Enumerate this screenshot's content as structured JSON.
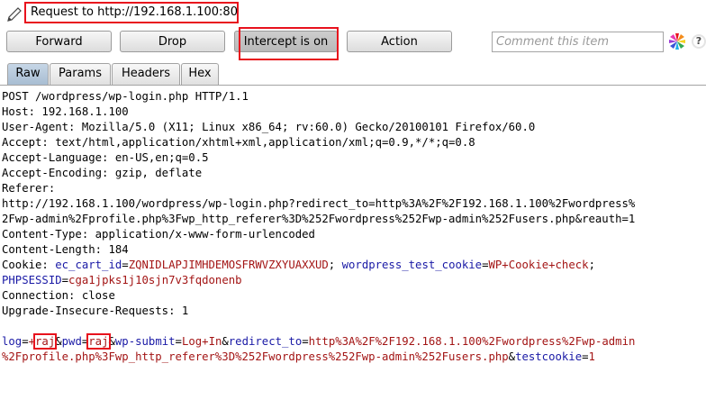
{
  "title": "Request to http://192.168.1.100:80",
  "toolbar": {
    "forward_label": "Forward",
    "drop_label": "Drop",
    "intercept_label": "Intercept is on",
    "action_label": "Action",
    "comment_placeholder": "Comment this item"
  },
  "icons": {
    "edit": "pencil-icon",
    "highlight": "color-palette-icon",
    "help": "help-icon"
  },
  "colors": {
    "param_name": "#1a1aa6",
    "param_value": "#a31515",
    "highlight_box": "#e8121d",
    "active_tab": "#a8bdd2"
  },
  "tabs": [
    "Raw",
    "Params",
    "Headers",
    "Hex"
  ],
  "request": {
    "request_line": "POST /wordpress/wp-login.php HTTP/1.1",
    "host": "Host: 192.168.1.100",
    "user_agent": "User-Agent: Mozilla/5.0 (X11; Linux x86_64; rv:60.0) Gecko/20100101 Firefox/60.0",
    "accept": "Accept: text/html,application/xhtml+xml,application/xml;q=0.9,*/*;q=0.8",
    "accept_language": "Accept-Language: en-US,en;q=0.5",
    "accept_encoding": "Accept-Encoding: gzip, deflate",
    "referer_label": "Referer:",
    "referer_line1": "http://192.168.1.100/wordpress/wp-login.php?redirect_to=http%3A%2F%2F192.168.1.100%2Fwordpress%",
    "referer_line2": "2Fwp-admin%2Fprofile.php%3Fwp_http_referer%3D%252Fwordpress%252Fwp-admin%252Fusers.php&reauth=1",
    "content_type": "Content-Type: application/x-www-form-urlencoded",
    "content_length": "Content-Length: 184",
    "cookie": {
      "label": "Cookie: ",
      "c1_name": "ec_cart_id",
      "c1_value": "ZQNIDLAPJIMHDEMOSFRWVZXYUAXXUD",
      "sep1": "; ",
      "c2_name": "wordpress_test_cookie",
      "c2_value": "WP+Cookie+check",
      "sep2": ";",
      "c3_name": "PHPSESSID",
      "c3_value": "cga1jpks1j10sjn7v3fqdonenb"
    },
    "connection": "Connection: close",
    "upgrade": "Upgrade-Insecure-Requests: 1",
    "body": {
      "p1_name": "log",
      "p1_value_prefix": "+",
      "p1_value": "raj",
      "p2_name": "pwd",
      "p2_value": "raj",
      "p3_name": "wp-submit",
      "p3_value": "Log+In",
      "p4_name": "redirect_to",
      "p4_value_line1": "http%3A%2F%2F192.168.1.100%2Fwordpress%2Fwp-admin",
      "p4_value_line2": "%2Fprofile.php%3Fwp_http_referer%3D%252Fwordpress%252Fwp-admin%252Fusers.php",
      "p5_name": "testcookie",
      "p5_value": "1",
      "eq": "=",
      "amp": "&"
    }
  }
}
